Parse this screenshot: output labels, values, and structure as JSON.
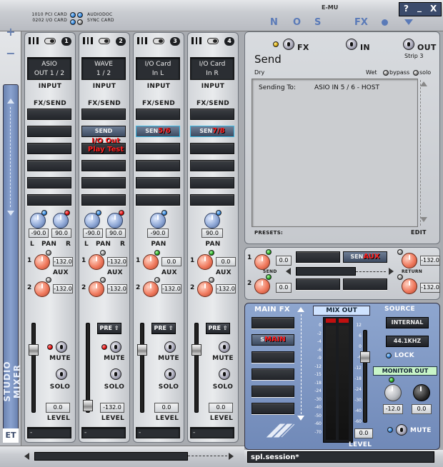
{
  "header": {
    "card_line1": "1010 PCI CARD",
    "card_line2": "0202 I/O CARD",
    "audio_dock": "AUDIODOC",
    "sync_card": "SYNC CARD",
    "brand": "E-MU",
    "nos_letters": [
      "N",
      "O",
      "S"
    ],
    "fx_label": "FX",
    "help": "?",
    "minimize": "_",
    "close": "X"
  },
  "sidebar": {
    "plus": "+",
    "minus": "−",
    "title": "STUDIO MIXER",
    "logo": "ET"
  },
  "strips": [
    {
      "num": "1",
      "input_line1": "ASIO",
      "input_line2": "OUT 1 / 2",
      "input_label": "INPUT",
      "fxsend": "FX/SEND",
      "send_label": "",
      "send_overlay": "",
      "pan_left": "-90.0",
      "pan_right": "90.0",
      "pan_l": "L",
      "pan_mid": "PAN",
      "pan_r": "R",
      "aux1": "-132.0",
      "aux2": "-132.0",
      "aux_label": "AUX",
      "pre": "",
      "mute": "MUTE",
      "solo": "SOLO",
      "level": "0.0",
      "level_label": "LEVEL",
      "name": "-"
    },
    {
      "num": "2",
      "input_line1": "WAVE",
      "input_line2": "1 / 2",
      "input_label": "INPUT",
      "fxsend": "FX/SEND",
      "send_label": "SEND",
      "send_overlay": "I/O Out\nPlay Test",
      "pan_left": "-90.0",
      "pan_right": "90.0",
      "pan_l": "L",
      "pan_mid": "PAN",
      "pan_r": "R",
      "aux1": "-132.0",
      "aux2": "-132.0",
      "aux_label": "AUX",
      "pre": "PRE",
      "mute": "MUTE",
      "solo": "SOLO",
      "level": "-132.0",
      "level_label": "LEVEL",
      "name": "-"
    },
    {
      "num": "3",
      "input_line1": "I/O Card",
      "input_line2": "In L",
      "input_label": "INPUT",
      "fxsend": "FX/SEND",
      "send_label": "SEN",
      "send_overlay": "5/6",
      "pan_left": "-90.0",
      "pan_right": "",
      "pan_l": "",
      "pan_mid": "PAN",
      "pan_r": "",
      "aux1": "0.0",
      "aux2": "-132.0",
      "aux_label": "AUX",
      "pre": "PRE",
      "mute": "MUTE",
      "solo": "SOLO",
      "level": "0.0",
      "level_label": "LEVEL",
      "name": "-"
    },
    {
      "num": "4",
      "input_line1": "I/O Card",
      "input_line2": "In R",
      "input_label": "INPUT",
      "fxsend": "FX/SEND",
      "send_label": "SEN",
      "send_overlay": "7/8",
      "pan_left": "",
      "pan_right": "90.0",
      "pan_l": "",
      "pan_mid": "PAN",
      "pan_r": "",
      "aux1": "0.0",
      "aux2": "-132.0",
      "aux_label": "AUX",
      "pre": "PRE",
      "mute": "MUTE",
      "solo": "SOLO",
      "level": "0.0",
      "level_label": "LEVEL",
      "name": "-"
    }
  ],
  "insert_panel": {
    "fx": "FX",
    "in": "IN",
    "out": "OUT",
    "strip": "Strip 3",
    "title": "Send",
    "dry": "Dry",
    "wet": "Wet",
    "bypass": "bypass",
    "solo": "solo",
    "sending_to_label": "Sending To:",
    "sending_to_value": "ASIO IN 5 / 6 - HOST",
    "presets": "PRESETS:",
    "edit": "EDIT"
  },
  "aux_panel": {
    "send1_val": "0.0",
    "send2_val": "0.0",
    "send_label": "SEND",
    "sen_btn": "SEN",
    "sen_overlay": "AUX",
    "ret1_val": "-132.0",
    "ret2_val": "-132.0",
    "return_label": "RETURN",
    "row1_num": "1",
    "row2_num": "2"
  },
  "main": {
    "main_fx": "MAIN FX",
    "sm_btn": "S",
    "sm_overlay": "MAIN",
    "mix_out": "MIX OUT",
    "source": "SOURCE",
    "internal": "INTERNAL",
    "rate": "44.1KHZ",
    "lock": "LOCK",
    "monitor_out": "MONITOR OUT",
    "mon_left": "-12.0",
    "mon_right": "0.0",
    "mute": "MUTE",
    "level_val": "0.0",
    "level_label": "LEVEL",
    "meter_scale": [
      "0",
      "-2",
      "-4",
      "-6",
      "-9",
      "-12",
      "-15",
      "-18",
      "-24",
      "-30",
      "-40",
      "-50",
      "-60",
      "-70"
    ],
    "fader_scale": [
      "12",
      "6",
      "0",
      "-6",
      "-12",
      "-18",
      "-24",
      "-30",
      "-40",
      "-60",
      "-∞"
    ]
  },
  "footer": {
    "session": "spl.session*"
  }
}
